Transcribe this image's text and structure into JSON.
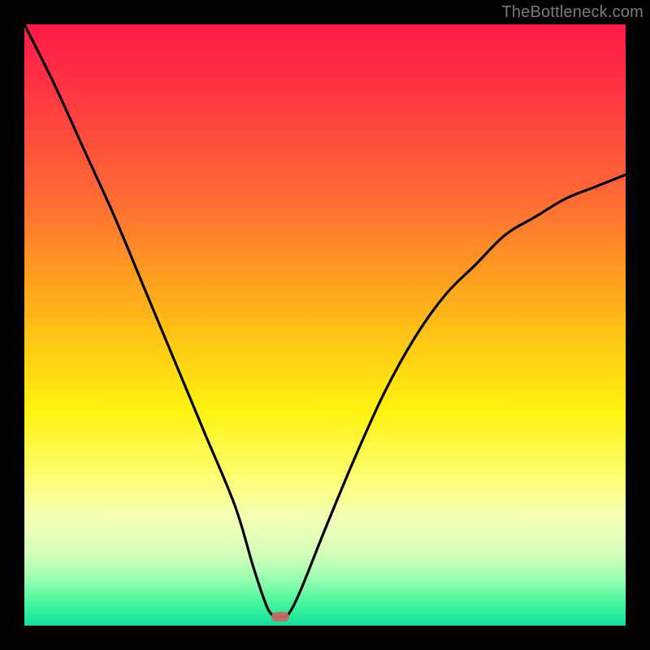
{
  "watermark": "TheBottleneck.com",
  "marker": {
    "x_frac": 0.425,
    "y_frac": 0.985
  },
  "chart_data": {
    "type": "line",
    "title": "",
    "xlabel": "",
    "ylabel": "",
    "xlim": [
      0,
      100
    ],
    "ylim": [
      0,
      100
    ],
    "grid": false,
    "legend": false,
    "series": [
      {
        "name": "bottleneck-curve",
        "x": [
          0,
          5,
          10,
          15,
          20,
          25,
          30,
          35,
          38,
          40,
          41,
          42,
          43,
          44,
          46,
          50,
          55,
          60,
          65,
          70,
          75,
          80,
          85,
          90,
          95,
          100
        ],
        "y": [
          100,
          90,
          79,
          68,
          56,
          44,
          32,
          20,
          10,
          4,
          2,
          1.5,
          1.5,
          2,
          6,
          16,
          28,
          39,
          48,
          55,
          60,
          65,
          68,
          71,
          73,
          75
        ]
      }
    ],
    "annotations": [
      {
        "type": "marker",
        "x": 42.5,
        "y": 1.5,
        "color": "#c56a64"
      }
    ],
    "background_gradient": {
      "direction": "vertical",
      "stops": [
        {
          "pos": 0.0,
          "color": "#ff1a47"
        },
        {
          "pos": 0.5,
          "color": "#ffcc14"
        },
        {
          "pos": 0.8,
          "color": "#fdfe79"
        },
        {
          "pos": 1.0,
          "color": "#14d99b"
        }
      ]
    }
  }
}
